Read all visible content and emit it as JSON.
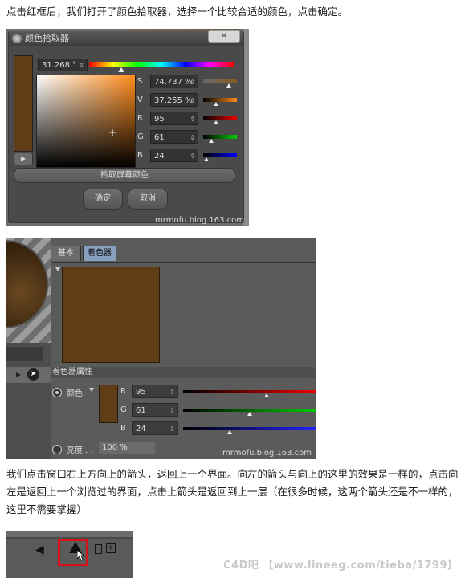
{
  "text": {
    "p1": "点击红框后，我们打开了颜色拾取器，选择一个比较合适的颜色，点击确定。",
    "p2": "我们点击窗口右上方向上的箭头，返回上一个界面。向左的箭头与向上的这里的效果是一样的，点击向左是返回上一个浏览过的界面，点击上箭头是返回到上一层（在很多时候，这两个箭头还是不一样的，这里不需要掌握）"
  },
  "picker": {
    "title": "颜色拾取器",
    "close": "×",
    "hue": "31.268 °",
    "hue_fraction": 0.087,
    "rows": [
      {
        "label": "S",
        "value": "74.737 %",
        "fraction": 0.75,
        "gradient": "linear-gradient(90deg,#6a6a6a,#8a5a20)"
      },
      {
        "label": "V",
        "value": "37.255 %",
        "fraction": 0.37,
        "gradient": "linear-gradient(90deg,#000,#ff8a1a)"
      },
      {
        "label": "R",
        "value": "95",
        "fraction": 0.37,
        "gradient": "linear-gradient(90deg,#000,#e00)"
      },
      {
        "label": "G",
        "value": "61",
        "fraction": 0.24,
        "gradient": "linear-gradient(90deg,#000,#0c0)"
      },
      {
        "label": "B",
        "value": "24",
        "fraction": 0.09,
        "gradient": "linear-gradient(90deg,#000,#00f)"
      }
    ],
    "pick_screen": "拾取屏幕颜色",
    "ok": "确定",
    "cancel": "取消",
    "watermark": "mrmofu.blog.163.com"
  },
  "material": {
    "tab_basic": "基本",
    "tab_color": "着色器",
    "section": "着色器属性",
    "color_label": "颜色",
    "rows": [
      {
        "label": "R",
        "value": "95",
        "fraction": 0.37,
        "gradient": "linear-gradient(90deg,#000,#e00)"
      },
      {
        "label": "G",
        "value": "61",
        "fraction": 0.24,
        "gradient": "linear-gradient(90deg,#000,#0c0)"
      },
      {
        "label": "B",
        "value": "24",
        "fraction": 0.09,
        "gradient": "linear-gradient(90deg,#000,#22f)"
      }
    ],
    "brightness_label": "亮度 . .",
    "brightness": "100 %",
    "watermark": "mrmofu.blog.163.com",
    "color_hex": "#5f3d17"
  },
  "toolbar": {
    "back": "◀",
    "plus": "+"
  },
  "footer_watermark": "C4D吧 【www.lineeg.com/tieba/1799】"
}
